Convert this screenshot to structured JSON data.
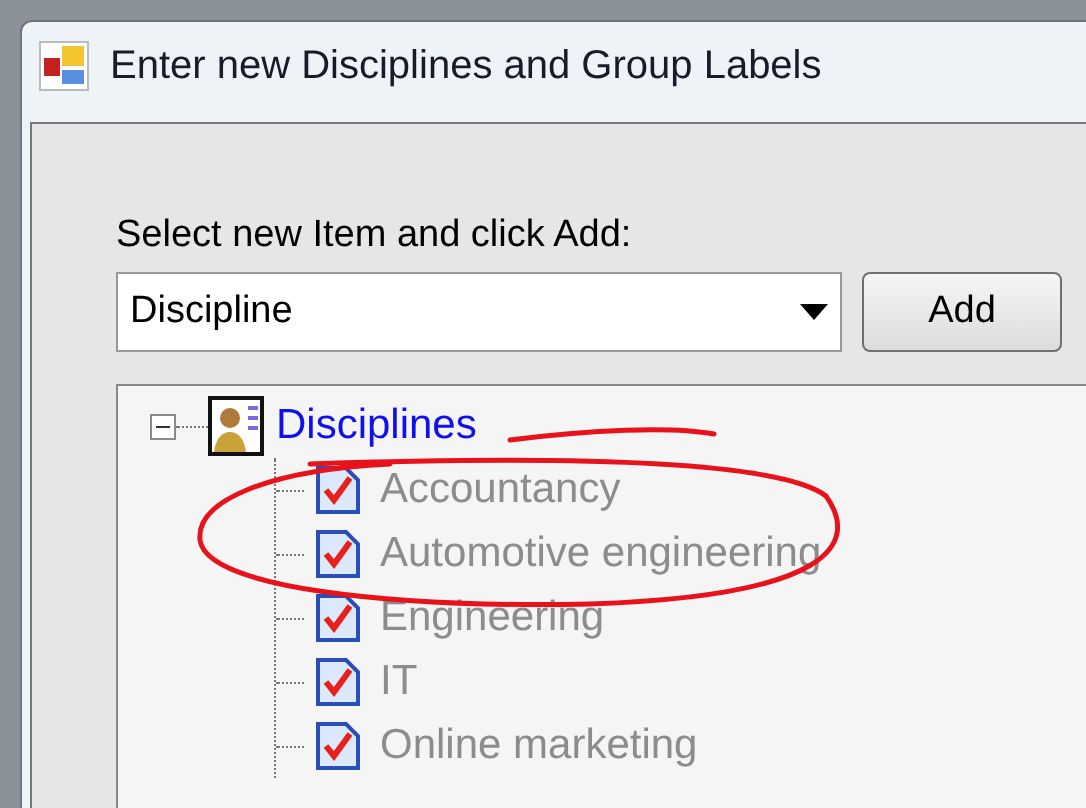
{
  "window": {
    "title": "Enter new Disciplines and Group Labels"
  },
  "prompt": "Select new Item and click Add:",
  "combo": {
    "value": "Discipline"
  },
  "add_button": "Add",
  "tree": [
    {
      "label": "Disciplines",
      "expanded": true,
      "children": [
        {
          "label": "Accountancy",
          "checked": true,
          "disabled": true
        },
        {
          "label": "Automotive engineering",
          "checked": true,
          "disabled": true
        },
        {
          "label": "Engineering",
          "checked": true,
          "disabled": true
        },
        {
          "label": "IT",
          "checked": true,
          "disabled": true
        },
        {
          "label": "Online marketing",
          "checked": true,
          "disabled": true
        }
      ]
    }
  ]
}
